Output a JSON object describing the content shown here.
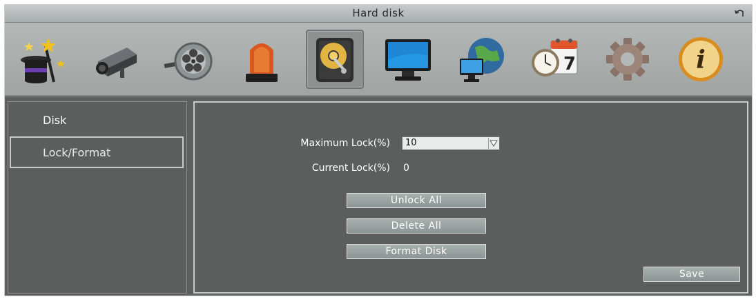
{
  "window": {
    "title": "Hard disk"
  },
  "toolbar": {
    "icons": [
      {
        "name": "wizard-hat-icon"
      },
      {
        "name": "camera-icon"
      },
      {
        "name": "film-reel-icon"
      },
      {
        "name": "alarm-light-icon"
      },
      {
        "name": "hard-disk-icon",
        "selected": true
      },
      {
        "name": "monitor-icon"
      },
      {
        "name": "network-icon"
      },
      {
        "name": "schedule-icon",
        "text": "7"
      },
      {
        "name": "settings-gear-icon"
      },
      {
        "name": "info-icon",
        "text": "i"
      }
    ]
  },
  "sidebar": {
    "items": [
      {
        "label": "Disk"
      },
      {
        "label": "Lock/Format",
        "selected": true
      }
    ]
  },
  "form": {
    "max_lock_label": "Maximum Lock(%)",
    "max_lock_value": "10",
    "current_lock_label": "Current Lock(%)",
    "current_lock_value": "0",
    "unlock_all": "Unlock All",
    "delete_all": "Delete All",
    "format_disk": "Format Disk",
    "save": "Save"
  },
  "colors": {
    "background": "#5e5f5f",
    "toolbar": "#a9aead",
    "titlebar": "#b7bbbb",
    "button": "#98a09e",
    "border_light": "#c6cbcb"
  }
}
